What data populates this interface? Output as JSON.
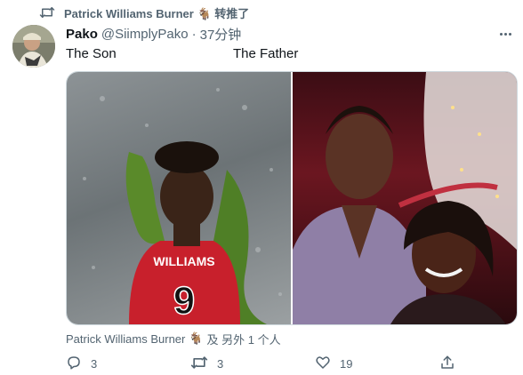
{
  "retweet": {
    "icon": "retweet-icon",
    "name": "Patrick Williams Burner",
    "badge_emoji": "🐐",
    "suffix": "转推了"
  },
  "tweet": {
    "author_name": "Pako",
    "handle": "@SiimplyPako",
    "separator": "·",
    "time": "37分钟",
    "text_left": "The Son",
    "text_right": "The Father",
    "images": [
      {
        "subject": "player-in-red-jersey-9"
      },
      {
        "subject": "man-and-woman-selfie"
      }
    ],
    "jersey_name": "WILLIAMS",
    "jersey_number": "9",
    "tagged": {
      "name": "Patrick Williams Burner",
      "badge_emoji": "🐐",
      "suffix": "及 另外 1 个人"
    }
  },
  "actions": {
    "reply_count": "3",
    "retweet_count": "3",
    "like_count": "19"
  },
  "colors": {
    "text_primary": "#0f1419",
    "text_secondary": "#536471",
    "border": "#cfd9de"
  }
}
